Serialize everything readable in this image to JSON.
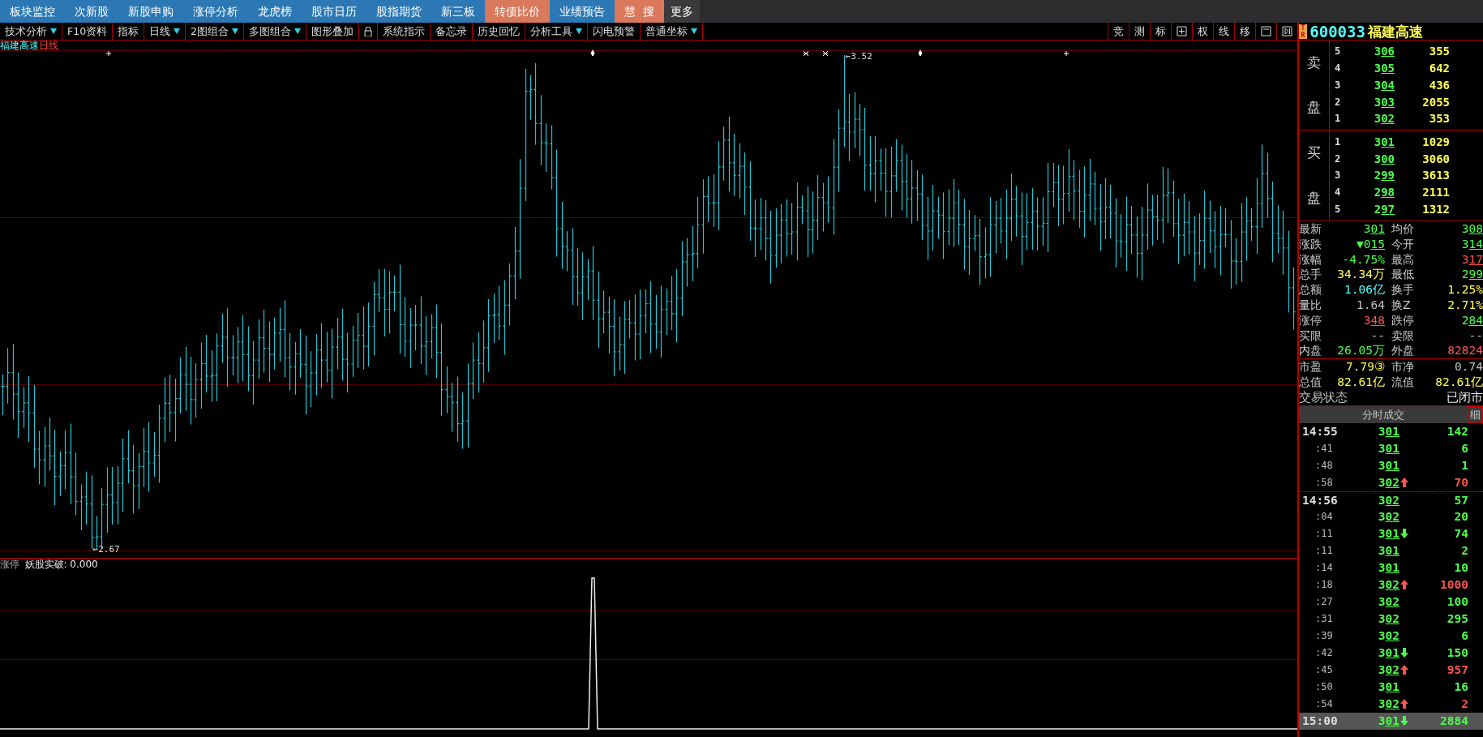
{
  "top_menu": [
    {
      "label": "板块监控",
      "kind": "normal"
    },
    {
      "label": "次新股",
      "kind": "normal"
    },
    {
      "label": "新股申购",
      "kind": "normal"
    },
    {
      "label": "涨停分析",
      "kind": "normal"
    },
    {
      "label": "龙虎榜",
      "kind": "normal"
    },
    {
      "label": "股市日历",
      "kind": "normal"
    },
    {
      "label": "股指期货",
      "kind": "normal"
    },
    {
      "label": "新三板",
      "kind": "normal"
    },
    {
      "label": "转债比价",
      "kind": "accent"
    },
    {
      "label": "业绩预告",
      "kind": "normal"
    },
    {
      "label": "慧  搜",
      "kind": "accent"
    },
    {
      "label": "更多",
      "kind": "more"
    }
  ],
  "toolbar": [
    {
      "kind": "text",
      "label": "技术分析",
      "dropdown": true
    },
    {
      "kind": "text",
      "label": "F10资料",
      "dropdown": false
    },
    {
      "kind": "text",
      "label": "指标",
      "dropdown": false
    },
    {
      "kind": "text",
      "label": "日线",
      "dropdown": true
    },
    {
      "kind": "text",
      "label": "2图组合",
      "dropdown": true
    },
    {
      "kind": "text",
      "label": "多图组合",
      "dropdown": true
    },
    {
      "kind": "text",
      "label": "图形叠加",
      "dropdown": false
    },
    {
      "kind": "lock"
    },
    {
      "kind": "text",
      "label": "系统指示",
      "dropdown": false
    },
    {
      "kind": "text",
      "label": "备忘录",
      "dropdown": false
    },
    {
      "kind": "text",
      "label": "历史回忆",
      "dropdown": false
    },
    {
      "kind": "text",
      "label": "分析工具",
      "dropdown": true
    },
    {
      "kind": "text",
      "label": "闪电预警",
      "dropdown": false
    },
    {
      "kind": "text",
      "label": "普通坐标",
      "dropdown": true
    }
  ],
  "chart_tools": [
    {
      "kind": "text",
      "label": "竞"
    },
    {
      "kind": "text",
      "label": "测"
    },
    {
      "kind": "text",
      "label": "标"
    },
    {
      "kind": "grid"
    },
    {
      "kind": "text",
      "label": "权"
    },
    {
      "kind": "text",
      "label": "线"
    },
    {
      "kind": "text",
      "label": "移"
    },
    {
      "kind": "window"
    },
    {
      "kind": "play"
    }
  ],
  "chart": {
    "stock": "福建高速",
    "period": "日线",
    "high_label": "←3.52",
    "low_label": "←2.67"
  },
  "indicator": {
    "name": "涨停",
    "formula": "妖股实破: 0.000"
  },
  "quote": {
    "badge": [
      "T",
      "R"
    ],
    "code": "600033",
    "name": "福建高速"
  },
  "sell": {
    "label": [
      "卖",
      "盘"
    ],
    "rows": [
      {
        "level": "5",
        "price": "306",
        "volume": "355"
      },
      {
        "level": "4",
        "price": "305",
        "volume": "642"
      },
      {
        "level": "3",
        "price": "304",
        "volume": "436"
      },
      {
        "level": "2",
        "price": "303",
        "volume": "2055"
      },
      {
        "level": "1",
        "price": "302",
        "volume": "353"
      }
    ]
  },
  "buy": {
    "label": [
      "买",
      "盘"
    ],
    "rows": [
      {
        "level": "1",
        "price": "301",
        "volume": "1029"
      },
      {
        "level": "2",
        "price": "300",
        "volume": "3060"
      },
      {
        "level": "3",
        "price": "299",
        "volume": "3613"
      },
      {
        "level": "4",
        "price": "298",
        "volume": "2111"
      },
      {
        "level": "5",
        "price": "297",
        "volume": "1312"
      }
    ]
  },
  "stats": [
    [
      {
        "label": "最新",
        "value": "301",
        "color": "#4cff4c",
        "link": true
      },
      {
        "label": "均价",
        "value": "308",
        "color": "#4cff4c",
        "link": true
      }
    ],
    [
      {
        "label": "涨跌",
        "value": "▼015",
        "color": "#4cff4c",
        "link": true
      },
      {
        "label": "今开",
        "value": "314",
        "color": "#4cff4c",
        "link": true
      }
    ],
    [
      {
        "label": "涨幅",
        "value": "-4.75%",
        "color": "#4cff4c",
        "link": false
      },
      {
        "label": "最高",
        "value": "317",
        "color": "#ff5454",
        "link": true
      }
    ],
    [
      {
        "label": "总手",
        "value": "34.34万",
        "color": "#ffff54",
        "link": false
      },
      {
        "label": "最低",
        "value": "299",
        "color": "#4cff4c",
        "link": true
      }
    ],
    [
      {
        "label": "总额",
        "value": "1.06亿",
        "color": "#54ffff",
        "link": false
      },
      {
        "label": "换手",
        "value": "1.25%",
        "color": "#ffff54",
        "link": false
      }
    ],
    [
      {
        "label": "量比",
        "value": "1.64",
        "color": "#c0c0c0",
        "link": false
      },
      {
        "label": "换Z",
        "value": "2.71%",
        "color": "#ffff54",
        "link": false
      }
    ],
    [
      {
        "label": "涨停",
        "value": "348",
        "color": "#ff5454",
        "link": true
      },
      {
        "label": "跌停",
        "value": "284",
        "color": "#4cff4c",
        "link": true
      }
    ],
    [
      {
        "label": "买限",
        "value": "--",
        "color": "#c0c0c0",
        "link": false
      },
      {
        "label": "卖限",
        "value": "--",
        "color": "#c0c0c0",
        "link": false
      }
    ],
    [
      {
        "label": "内盘",
        "value": "26.05万",
        "color": "#4cff4c",
        "link": false
      },
      {
        "label": "外盘",
        "value": "82824",
        "color": "#ff5454",
        "link": false
      }
    ]
  ],
  "valuation": [
    [
      {
        "label": "市盈",
        "value": "7.79③",
        "color": "#ffff54"
      },
      {
        "label": "市净",
        "value": "0.74",
        "color": "#c0c0c0"
      }
    ],
    [
      {
        "label": "总值",
        "value": "82.61亿",
        "color": "#ffff54"
      },
      {
        "label": "流值",
        "value": "82.61亿",
        "color": "#ffff54"
      }
    ]
  ],
  "trade_status": {
    "label": "交易状态",
    "value": "已闭市"
  },
  "ticks_header": {
    "title": "分时成交",
    "button": "细"
  },
  "ticks": [
    {
      "time": "14:55",
      "kind": "minute",
      "price": "301",
      "rise": false,
      "fall": false,
      "volume": "142",
      "selected": false
    },
    {
      "time": ":41",
      "kind": "second",
      "price": "301",
      "rise": false,
      "fall": false,
      "volume": "6",
      "selected": false
    },
    {
      "time": ":48",
      "kind": "second",
      "price": "301",
      "rise": false,
      "fall": false,
      "volume": "1",
      "selected": false
    },
    {
      "time": ":58",
      "kind": "second",
      "price": "302",
      "rise": true,
      "fall": false,
      "volume": "70",
      "selected": false
    },
    {
      "time": "14:56",
      "kind": "minute",
      "price": "302",
      "rise": false,
      "fall": false,
      "volume": "57",
      "selected": false
    },
    {
      "time": ":04",
      "kind": "second",
      "price": "302",
      "rise": false,
      "fall": false,
      "volume": "20",
      "selected": false
    },
    {
      "time": ":11",
      "kind": "second",
      "price": "301",
      "rise": false,
      "fall": true,
      "volume": "74",
      "selected": false
    },
    {
      "time": ":11",
      "kind": "second",
      "price": "301",
      "rise": false,
      "fall": false,
      "volume": "2",
      "selected": false
    },
    {
      "time": ":14",
      "kind": "second",
      "price": "301",
      "rise": false,
      "fall": false,
      "volume": "10",
      "selected": false
    },
    {
      "time": ":18",
      "kind": "second",
      "price": "302",
      "rise": true,
      "fall": false,
      "volume": "1000",
      "selected": false
    },
    {
      "time": ":27",
      "kind": "second",
      "price": "302",
      "rise": false,
      "fall": false,
      "volume": "100",
      "selected": false
    },
    {
      "time": ":31",
      "kind": "second",
      "price": "302",
      "rise": false,
      "fall": false,
      "volume": "295",
      "selected": false
    },
    {
      "time": ":39",
      "kind": "second",
      "price": "302",
      "rise": false,
      "fall": false,
      "volume": "6",
      "selected": false
    },
    {
      "time": ":42",
      "kind": "second",
      "price": "301",
      "rise": false,
      "fall": true,
      "volume": "150",
      "selected": false
    },
    {
      "time": ":45",
      "kind": "second",
      "price": "302",
      "rise": true,
      "fall": false,
      "volume": "957",
      "selected": false
    },
    {
      "time": ":50",
      "kind": "second",
      "price": "301",
      "rise": false,
      "fall": false,
      "volume": "16",
      "selected": false
    },
    {
      "time": ":54",
      "kind": "second",
      "price": "302",
      "rise": true,
      "fall": false,
      "volume": "2",
      "selected": false
    },
    {
      "time": "15:00",
      "kind": "minute",
      "price": "301",
      "rise": false,
      "fall": true,
      "volume": "2884",
      "selected": true
    }
  ]
}
